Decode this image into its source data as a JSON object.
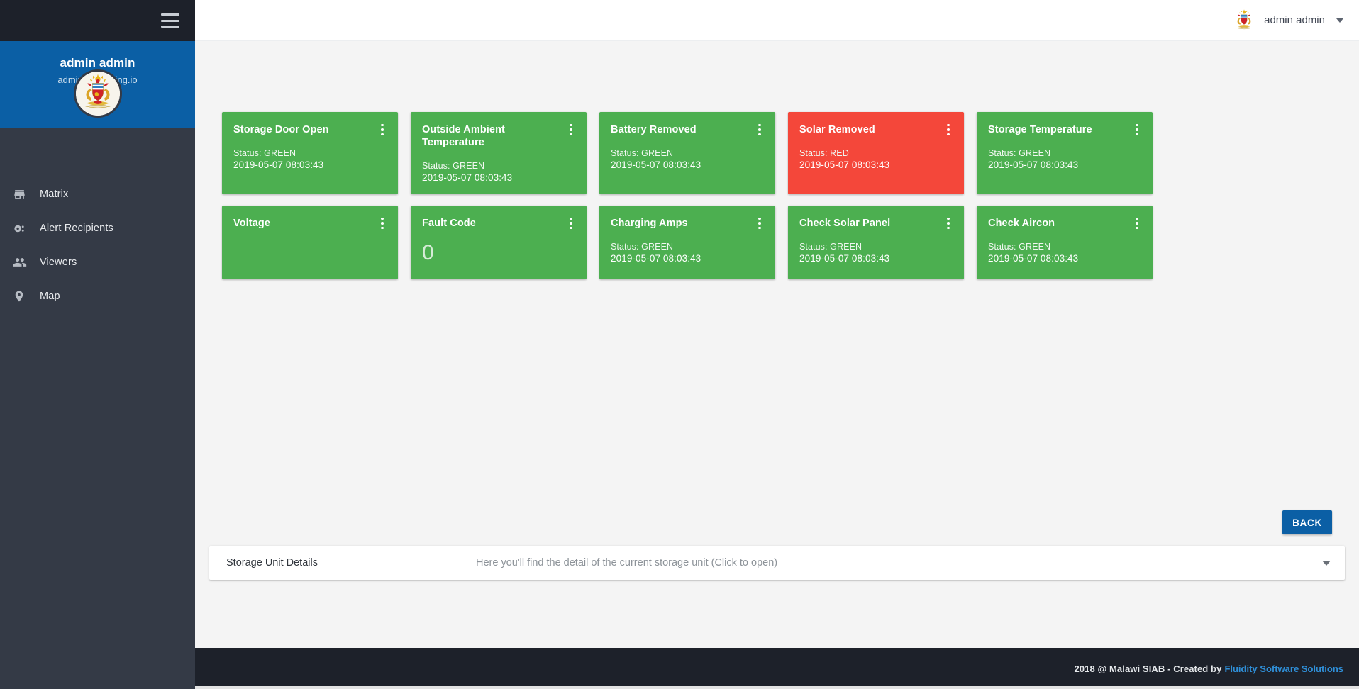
{
  "brand": {
    "accent_blue": "#0b5fa5",
    "status_green": "#4caf50",
    "status_red": "#f4473a",
    "sidebar_dark": "#343a46",
    "topbar_dark": "#1d212a"
  },
  "sidebar": {
    "profile": {
      "name": "admin admin",
      "email": "admin@thatthing.io",
      "avatar_alt": "malawi-coat-of-arms"
    },
    "items": [
      {
        "label": "Matrix",
        "icon": "store-icon"
      },
      {
        "label": "Alert Recipients",
        "icon": "settings-remote-icon"
      },
      {
        "label": "Viewers",
        "icon": "people-icon"
      },
      {
        "label": "Map",
        "icon": "location-pin-icon"
      }
    ]
  },
  "header": {
    "username": "admin admin",
    "avatar_alt": "malawi-coat-of-arms",
    "dropdown_icon": "chevron-down-icon"
  },
  "main": {
    "cards": [
      {
        "title": "Storage Door Open",
        "status_label": "Status: GREEN",
        "timestamp": "2019-05-07 08:03:43",
        "state": "green"
      },
      {
        "title": "Outside Ambient Temperature",
        "status_label": "Status: GREEN",
        "timestamp": "2019-05-07 08:03:43",
        "state": "green"
      },
      {
        "title": "Battery Removed",
        "status_label": "Status: GREEN",
        "timestamp": "2019-05-07 08:03:43",
        "state": "green"
      },
      {
        "title": "Solar Removed",
        "status_label": "Status: RED",
        "timestamp": "2019-05-07 08:03:43",
        "state": "red"
      },
      {
        "title": "Storage Temperature",
        "status_label": "Status: GREEN",
        "timestamp": "2019-05-07 08:03:43",
        "state": "green"
      },
      {
        "title": "Voltage",
        "status_label": "",
        "timestamp": "",
        "state": "green"
      },
      {
        "title": "Fault Code",
        "status_label": "",
        "timestamp": "",
        "state": "green",
        "value": "0"
      },
      {
        "title": "Charging Amps",
        "status_label": "Status: GREEN",
        "timestamp": "2019-05-07 08:03:43",
        "state": "green"
      },
      {
        "title": "Check Solar Panel",
        "status_label": "Status: GREEN",
        "timestamp": "2019-05-07 08:03:43",
        "state": "green"
      },
      {
        "title": "Check Aircon",
        "status_label": "Status: GREEN",
        "timestamp": "2019-05-07 08:03:43",
        "state": "green"
      }
    ],
    "back_label": "BACK",
    "expansion": {
      "title": "Storage Unit Details",
      "description": "Here you'll find the detail of the current storage unit (Click to open)",
      "chevron_icon": "chevron-down-icon"
    }
  },
  "footer": {
    "text": "2018 @ Malawi SIAB - Created by",
    "link": "Fluidity Software Solutions"
  }
}
